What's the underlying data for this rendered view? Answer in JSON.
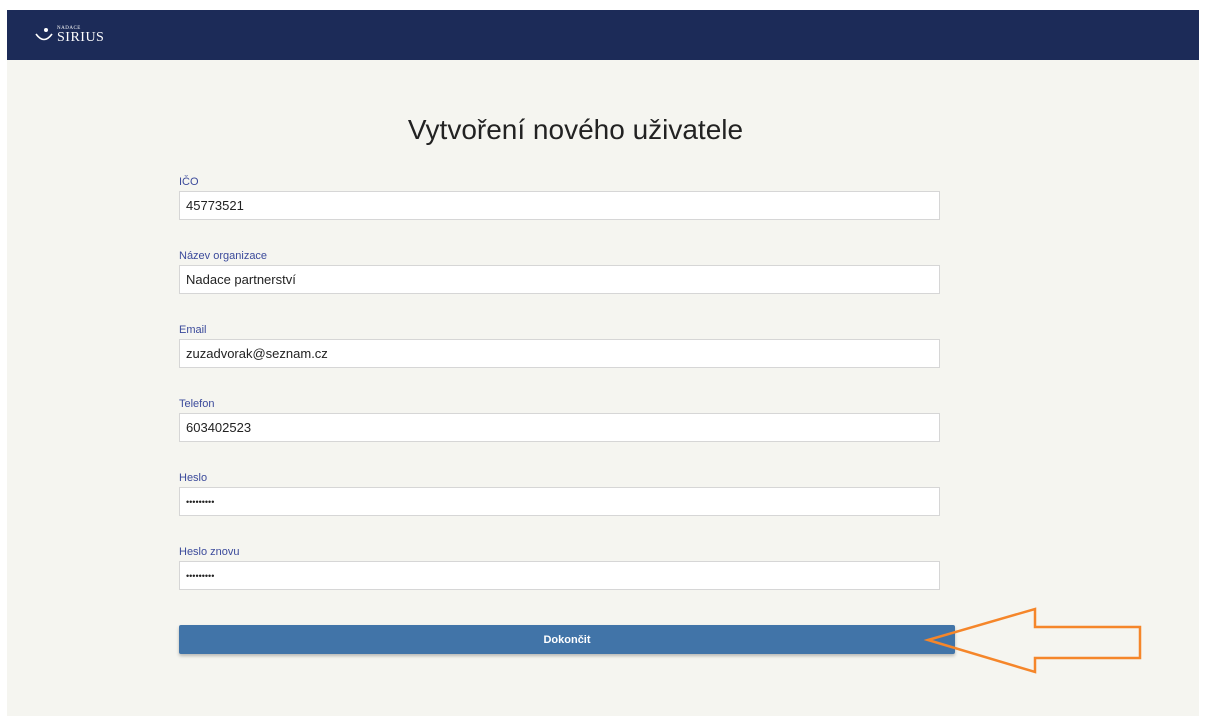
{
  "header": {
    "logo_small": "NADACE",
    "logo_big": "SIRIUS",
    "background_color": "#1c2b58"
  },
  "page": {
    "title": "Vytvoření nového uživatele"
  },
  "form": {
    "fields": [
      {
        "label": "IČO",
        "value": "45773521",
        "type": "text"
      },
      {
        "label": "Název organizace",
        "value": "Nadace partnerství",
        "type": "text"
      },
      {
        "label": "Email",
        "value": "zuzadvorak@seznam.cz",
        "type": "text"
      },
      {
        "label": "Telefon",
        "value": "603402523",
        "type": "text"
      },
      {
        "label": "Heslo",
        "value": "•••••••••",
        "type": "password"
      },
      {
        "label": "Heslo znovu",
        "value": "•••••••••",
        "type": "password"
      }
    ],
    "submit_label": "Dokončit",
    "submit_color": "#4174a8"
  },
  "annotation": {
    "icon": "arrow-left-icon",
    "color": "#f5862a"
  }
}
